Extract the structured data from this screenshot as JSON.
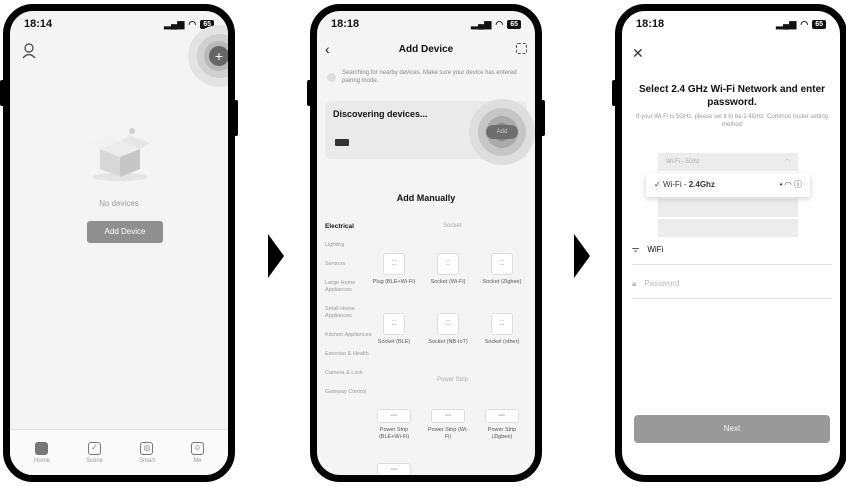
{
  "phone1": {
    "status": {
      "time": "18:14",
      "battery": "65"
    },
    "empty_text": "No devices",
    "add_device_label": "Add Device",
    "tabs": [
      {
        "label": "Home"
      },
      {
        "label": "Scene"
      },
      {
        "label": "Smart"
      },
      {
        "label": "Me"
      }
    ]
  },
  "phone2": {
    "status": {
      "time": "18:18",
      "battery": "65"
    },
    "title": "Add Device",
    "notice": "Searching for nearby devices. Make sure your device has entered pairing mode.",
    "discovering": "Discovering devices...",
    "add_small": "Add",
    "manual_title": "Add Manually",
    "categories": [
      "Electrical",
      "Lighting",
      "Sensors",
      "Large Home Appliances",
      "Small Home Appliances",
      "Kitchen Appliances",
      "Exercise & Health",
      "Camera & Lock",
      "Gateway Control"
    ],
    "section_socket": "Socket",
    "section_strip": "Power Strip",
    "socket_items": [
      "Plug (BLE+Wi-Fi)",
      "Socket (Wi-Fi)",
      "Socket (Zigbee)",
      "Socket (BLE)",
      "Socket (NB-IoT)",
      "Socket (other)"
    ],
    "strip_items": [
      "Power Strip (BLE+Wi-Fi)",
      "Power Strip (Wi-Fi)",
      "Power Strip (Zigbee)"
    ]
  },
  "phone3": {
    "status": {
      "time": "18:18",
      "battery": "65"
    },
    "title": "Select 2.4 GHz Wi-Fi Network and enter password.",
    "subtitle": "If your Wi-Fi is 5GHz, please set it to be 2.4GHz. Common router setting method",
    "wifi_5g": "Wi-Fi - 5Ghz",
    "wifi_24_prefix": "Wi-Fi - ",
    "wifi_24_band": "2.4Ghz",
    "wifi_field": "WiFi",
    "password_placeholder": "Password",
    "next_label": "Next"
  }
}
